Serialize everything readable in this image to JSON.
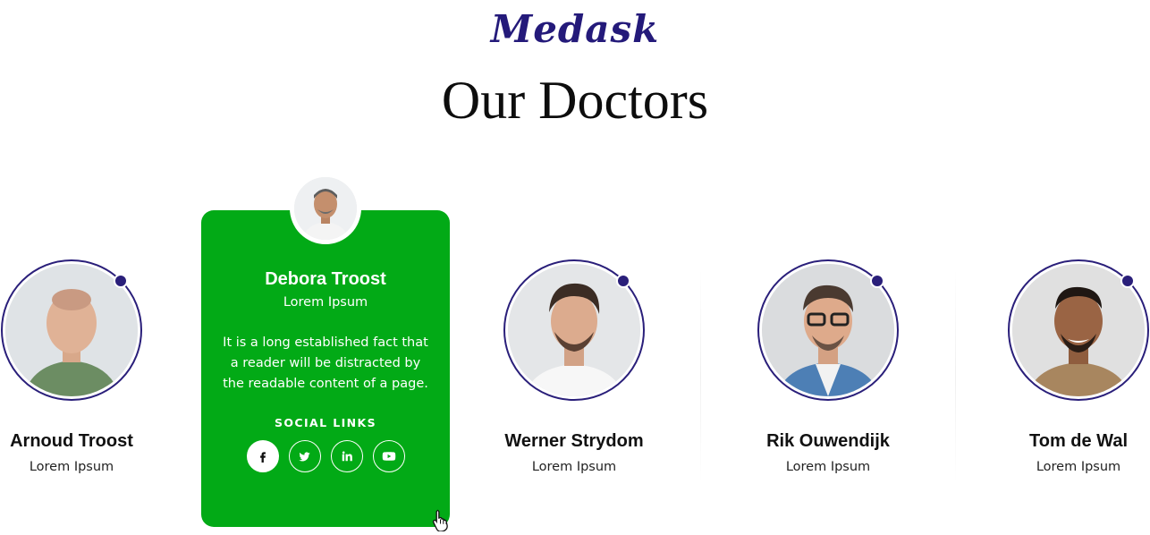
{
  "brand": "Medask",
  "heading": "Our Doctors",
  "doctors": [
    {
      "name": "Arnoud Troost",
      "role": "Lorem Ipsum"
    },
    {
      "name": "Werner Strydom",
      "role": "Lorem Ipsum"
    },
    {
      "name": "Rik Ouwendijk",
      "role": "Lorem Ipsum"
    },
    {
      "name": "Tom de Wal",
      "role": "Lorem Ipsum"
    }
  ],
  "featured": {
    "name": "Debora Troost",
    "role": "Lorem Ipsum",
    "bio": "It is a long established fact that a reader will be distracted by the readable content of a page.",
    "social_title": "SOCIAL LINKS",
    "social_icons": [
      "facebook-icon",
      "twitter-icon",
      "linkedin-icon",
      "youtube-icon"
    ]
  },
  "colors": {
    "brand": "#241a7a",
    "accent_green": "#02aa16",
    "ring": "#2a1f7a"
  }
}
